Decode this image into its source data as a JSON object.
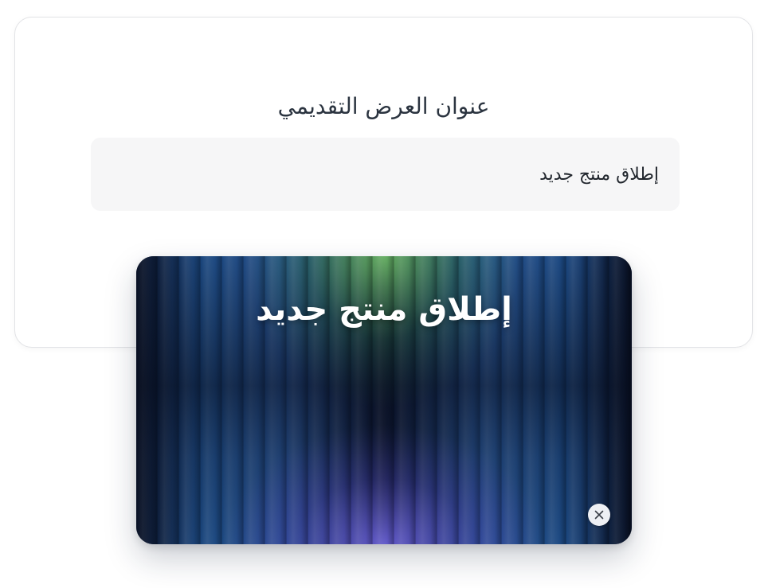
{
  "card": {
    "heading": "عنوان العرض التقديمي",
    "title_input_value": "إطلاق منتج جديد"
  },
  "preview": {
    "title": "إطلاق منتج جديد",
    "close_icon": "close-icon",
    "colors": {
      "top_glow": "#78d26e",
      "bottom_glow": "#6e64e6",
      "base": "#0c1733"
    }
  }
}
